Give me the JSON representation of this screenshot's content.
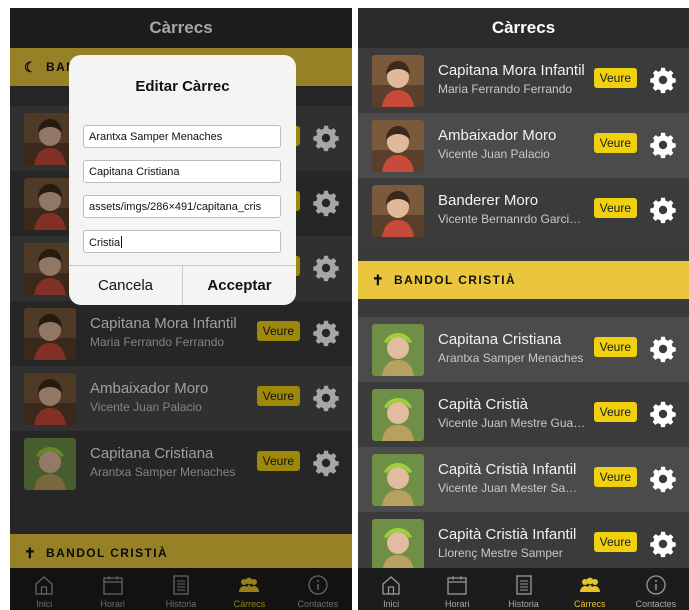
{
  "app": {
    "title": "Càrrecs"
  },
  "colors": {
    "accent": "#e9c63d",
    "button": "#f1d10f",
    "navbar": "#2b2b2b",
    "tabbar": "#1c1c1c"
  },
  "left": {
    "section_moor": {
      "icon": "moon-icon",
      "label": "BANDOL MORO"
    },
    "rows": [
      {
        "name": "",
        "subtitle": ""
      },
      {
        "name": "",
        "subtitle": ""
      },
      {
        "name": "",
        "subtitle": ""
      },
      {
        "name": "Capitana Mora Infantil",
        "subtitle": "Maria Ferrando Ferrando"
      },
      {
        "name": "Ambaixador Moro",
        "subtitle": "Vicente Juan Palacio"
      },
      {
        "name": "Capitana Cristiana",
        "subtitle": "Arantxa Samper Menaches"
      }
    ],
    "section_christian": {
      "icon": "cross-icon",
      "label": "BANDOL CRISTIÀ"
    },
    "dialog": {
      "title": "Editar Càrrec",
      "fields": [
        "Arantxa Samper Menaches",
        "Capitana Cristiana",
        "assets/imgs/286×491/capitana_cris",
        "Cristia"
      ],
      "cancel": "Cancela",
      "accept": "Acceptar"
    }
  },
  "right": {
    "rows_top": [
      {
        "name": "Capitana Mora Infantil",
        "subtitle": "Maria Ferrando Ferrando"
      },
      {
        "name": "Ambaixador Moro",
        "subtitle": "Vicente Juan Palacio"
      },
      {
        "name": "Banderer Moro",
        "subtitle": "Vicente Bernanrdo Garci…"
      }
    ],
    "section_christian": {
      "icon": "cross-icon",
      "label": "BANDOL CRISTIÀ"
    },
    "rows_bottom": [
      {
        "name": "Capitana Cristiana",
        "subtitle": "Arantxa Samper Menaches"
      },
      {
        "name": "Capità Cristià",
        "subtitle": "Vicente Juan Mestre Gua…"
      },
      {
        "name": "Capità Cristià Infantil",
        "subtitle": "Vicente Juan Mester Sa…"
      },
      {
        "name": "Capità Cristià Infantil",
        "subtitle": "Llorenç Mestre Samper"
      }
    ]
  },
  "row_button": "Veure",
  "tabs": [
    {
      "icon": "home-icon",
      "label": "Inici"
    },
    {
      "icon": "calendar-icon",
      "label": "Horari"
    },
    {
      "icon": "document-icon",
      "label": "Historia"
    },
    {
      "icon": "people-icon",
      "label": "Càrrecs",
      "active": true
    },
    {
      "icon": "info-icon",
      "label": "Contactes"
    }
  ]
}
